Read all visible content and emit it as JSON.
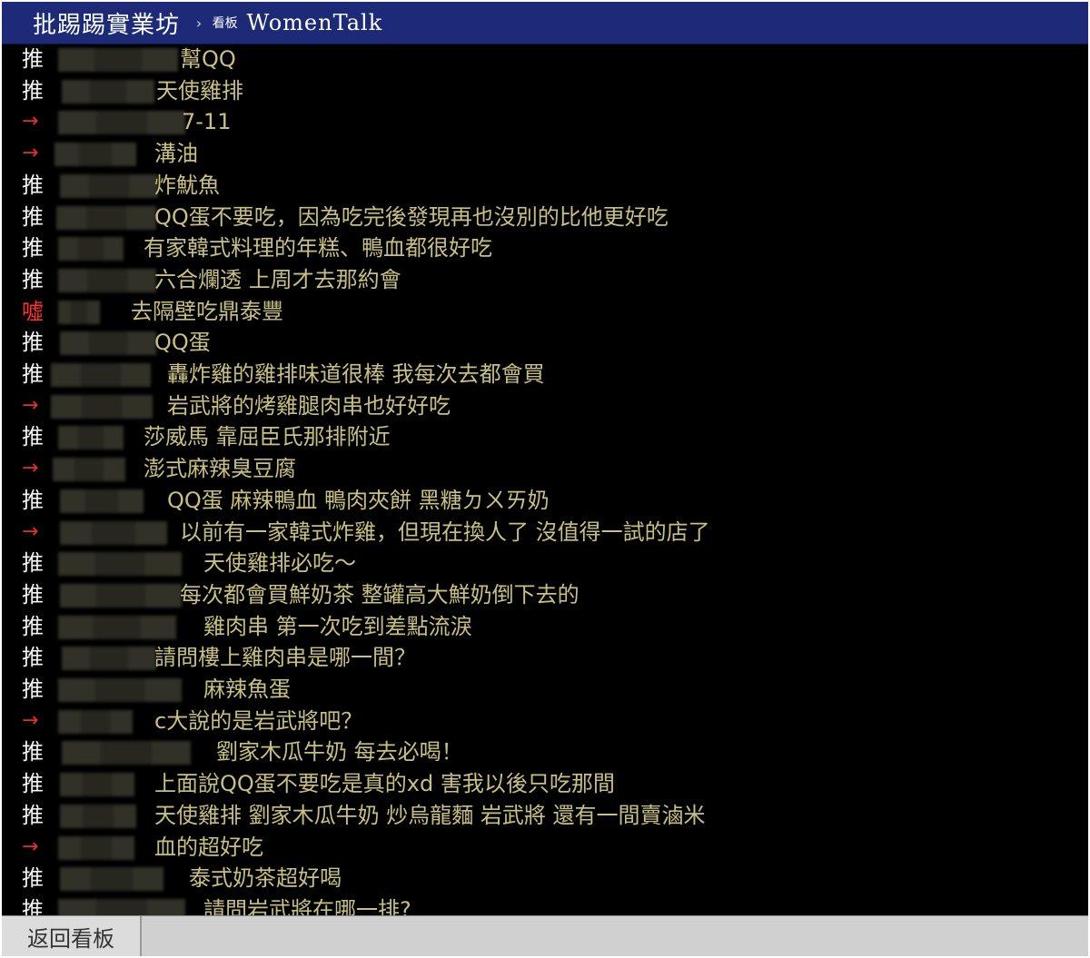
{
  "header": {
    "site_title": "批踢踢實業坊",
    "separator": "›",
    "board_prefix": "看板",
    "board_name": "WomenTalk"
  },
  "comments": [
    {
      "tag": "推",
      "kind": "push",
      "content": "幫QQ"
    },
    {
      "tag": "推",
      "kind": "push",
      "content": "天使雞排"
    },
    {
      "tag": "→",
      "kind": "arrow",
      "content": "7-11"
    },
    {
      "tag": "→",
      "kind": "arrow",
      "content": "溝油"
    },
    {
      "tag": "推",
      "kind": "push",
      "content": "炸魷魚"
    },
    {
      "tag": "推",
      "kind": "push",
      "content": "QQ蛋不要吃，因為吃完後發現再也沒別的比他更好吃"
    },
    {
      "tag": "推",
      "kind": "push",
      "content": "有家韓式料理的年糕、鴨血都很好吃"
    },
    {
      "tag": "推",
      "kind": "push",
      "content": "六合爛透 上周才去那約會"
    },
    {
      "tag": "噓",
      "kind": "boo",
      "content": "去隔壁吃鼎泰豐"
    },
    {
      "tag": "推",
      "kind": "push",
      "content": "QQ蛋"
    },
    {
      "tag": "推",
      "kind": "push",
      "content": "轟炸雞的雞排味道很棒 我每次去都會買"
    },
    {
      "tag": "→",
      "kind": "arrow",
      "content": "岩武將的烤雞腿肉串也好好吃"
    },
    {
      "tag": "推",
      "kind": "push",
      "content": "莎威馬 靠屈臣氏那排附近"
    },
    {
      "tag": "→",
      "kind": "arrow",
      "content": "澎式麻辣臭豆腐"
    },
    {
      "tag": "推",
      "kind": "push",
      "content": "QQ蛋 麻辣鴨血 鴨肉夾餅 黑糖ㄉㄨㄞ奶"
    },
    {
      "tag": "→",
      "kind": "arrow",
      "content": "以前有一家韓式炸雞，但現在換人了 沒值得一試的店了"
    },
    {
      "tag": "推",
      "kind": "push",
      "content": "天使雞排必吃～"
    },
    {
      "tag": "推",
      "kind": "push",
      "content": "每次都會買鮮奶茶 整罐高大鮮奶倒下去的"
    },
    {
      "tag": "推",
      "kind": "push",
      "content": "雞肉串 第一次吃到差點流淚"
    },
    {
      "tag": "推",
      "kind": "push",
      "content": "請問樓上雞肉串是哪一間？"
    },
    {
      "tag": "推",
      "kind": "push",
      "content": "麻辣魚蛋"
    },
    {
      "tag": "→",
      "kind": "arrow",
      "content": "c大說的是岩武將吧？"
    },
    {
      "tag": "推",
      "kind": "push",
      "content": "劉家木瓜牛奶 每去必喝！"
    },
    {
      "tag": "推",
      "kind": "push",
      "content": "上面說QQ蛋不要吃是真的xd 害我以後只吃那間"
    },
    {
      "tag": "推",
      "kind": "push",
      "content": "天使雞排 劉家木瓜牛奶 炒烏龍麵 岩武將 還有一間賣滷米"
    },
    {
      "tag": "→",
      "kind": "arrow",
      "content": "血的超好吃"
    },
    {
      "tag": "推",
      "kind": "push",
      "content": "泰式奶茶超好喝"
    },
    {
      "tag": "推",
      "kind": "push",
      "content": "請問岩武將在哪一排?"
    }
  ],
  "footer": {
    "back_label": "返回看板"
  },
  "colors": {
    "header_bg": "#1c2a78",
    "push_text": "#f2f2f2",
    "arrow_text": "#e03030",
    "boo_text": "#ff3030",
    "comment_text": "#c8c080",
    "footer_bg": "#d0d0d0"
  }
}
